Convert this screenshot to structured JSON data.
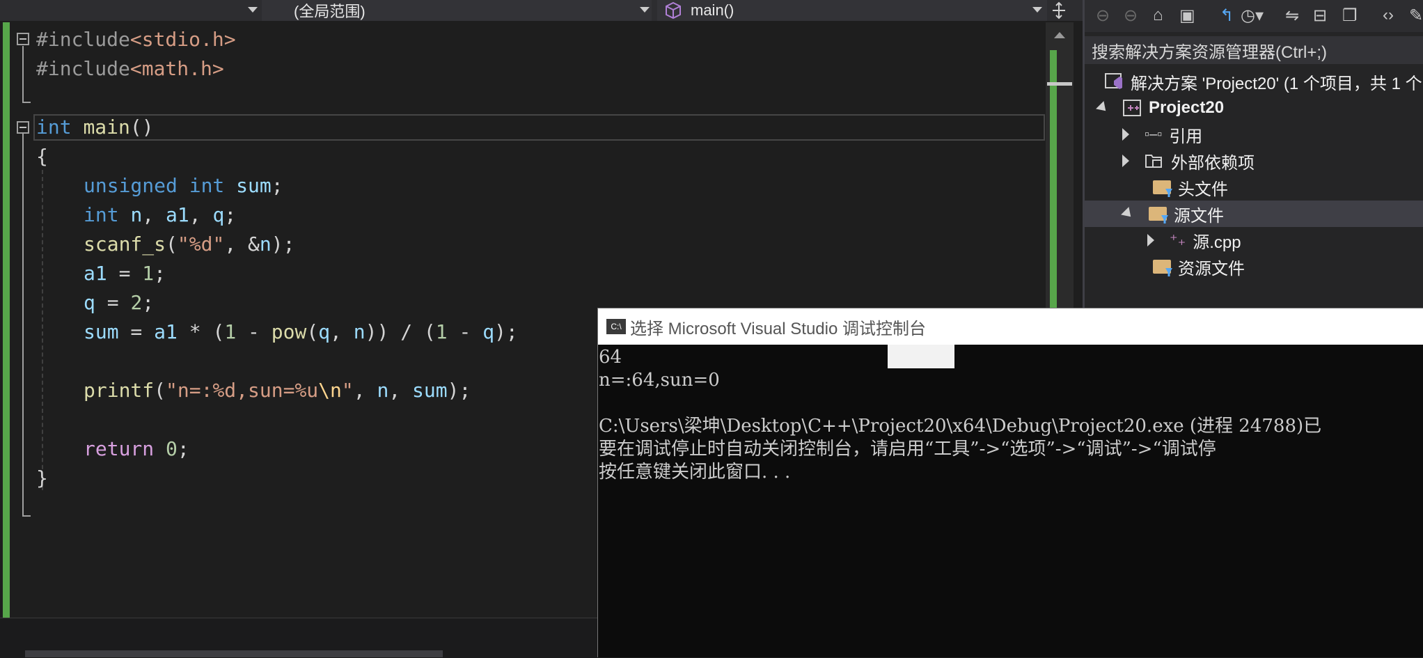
{
  "navbar": {
    "scope": "(全局范围)",
    "function": "main()"
  },
  "code": {
    "lines": [
      {
        "pp": "#include",
        "inc": "<stdio.h>"
      },
      {
        "pp": "#include",
        "inc": "<math.h>"
      }
    ],
    "main_kw": "int",
    "main_fn": "main",
    "main_paren": "()",
    "brace_open": "{",
    "l1_kw1": "unsigned",
    "l1_kw2": "int",
    "l1_var": "sum",
    "l1_end": ";",
    "l2_kw": "int",
    "l2_vars": [
      "n",
      "a1",
      "q"
    ],
    "l3_fn": "scanf_s",
    "l3_str": "\"%d\"",
    "l3_var": "n",
    "l4_var": "a1",
    "l4_num": "1",
    "l5_var": "q",
    "l5_num": "2",
    "l6_sum": "sum",
    "l6_a1": "a1",
    "l6_one": "1",
    "l6_pow": "pow",
    "l6_q": "q",
    "l6_n": "n",
    "l6_one2": "1",
    "l6_q2": "q",
    "l7_fn": "printf",
    "l7_str1": "\"n=:%d,sun=%u",
    "l7_esc": "\\n",
    "l7_str2": "\"",
    "l7_n": "n",
    "l7_sum": "sum",
    "l8_kw": "return",
    "l8_num": "0",
    "brace_close": "}"
  },
  "solution_explorer": {
    "search_placeholder": "搜索解决方案资源管理器(Ctrl+;)",
    "solution": "解决方案 'Project20' (1 个项目，共 1 个",
    "project": "Project20",
    "items": [
      {
        "label": "引用"
      },
      {
        "label": "外部依赖项"
      },
      {
        "label": "头文件"
      },
      {
        "label": "源文件"
      },
      {
        "label": "源.cpp"
      },
      {
        "label": "资源文件"
      }
    ]
  },
  "console": {
    "title": "选择 Microsoft Visual Studio 调试控制台",
    "lines": [
      "64",
      "n=:64,sun=0",
      "",
      "C:\\Users\\梁坤\\Desktop\\C++\\Project20\\x64\\Debug\\Project20.exe (进程 24788)已",
      "要在调试停止时自动关闭控制台，请启用“工具”->“选项”->“调试”->“调试停",
      "按任意键关闭此窗口. . ."
    ]
  },
  "colors": {
    "accent_green": "#57a64a",
    "keyword": "#569cd6",
    "string": "#d69d85",
    "function": "#dcdcaa",
    "variable": "#9cdcfe"
  }
}
